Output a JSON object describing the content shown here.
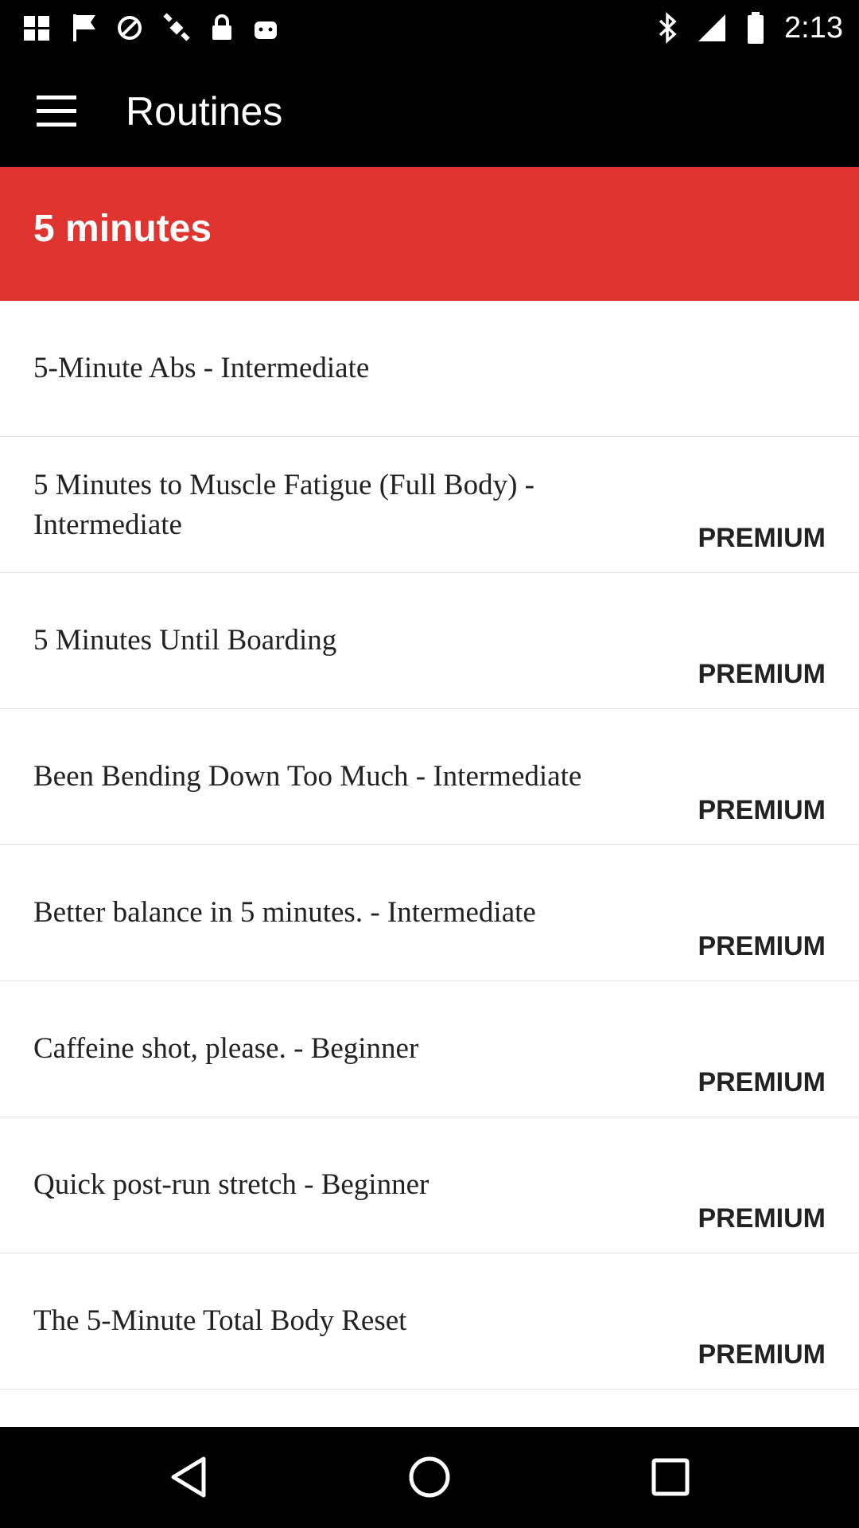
{
  "status_bar": {
    "time": "2:13",
    "left_icons": [
      "grid-app-icon",
      "flag-app-icon",
      "blocked-icon",
      "satellite-icon",
      "lock-icon",
      "android-icon"
    ],
    "right_icons": [
      "bluetooth-icon",
      "signal-icon",
      "battery-icon"
    ]
  },
  "app_bar": {
    "title": "Routines"
  },
  "section": {
    "title": "5 minutes",
    "color": "#e03431"
  },
  "items": [
    {
      "title": "5-Minute Abs - Intermediate",
      "badge": ""
    },
    {
      "title": "5 Minutes to Muscle Fatigue (Full Body) - Intermediate",
      "badge": "PREMIUM"
    },
    {
      "title": "5 Minutes Until Boarding",
      "badge": "PREMIUM"
    },
    {
      "title": "Been Bending Down Too Much - Intermediate",
      "badge": "PREMIUM"
    },
    {
      "title": "Better balance in 5 minutes. - Intermediate",
      "badge": "PREMIUM"
    },
    {
      "title": "Caffeine shot, please. - Beginner",
      "badge": "PREMIUM"
    },
    {
      "title": "Quick post-run stretch - Beginner",
      "badge": "PREMIUM"
    },
    {
      "title": "The 5-Minute Total Body Reset",
      "badge": "PREMIUM"
    },
    {
      "title": "",
      "badge": ""
    }
  ],
  "nav": {
    "icons": [
      "back-icon",
      "home-icon",
      "recents-icon"
    ]
  }
}
